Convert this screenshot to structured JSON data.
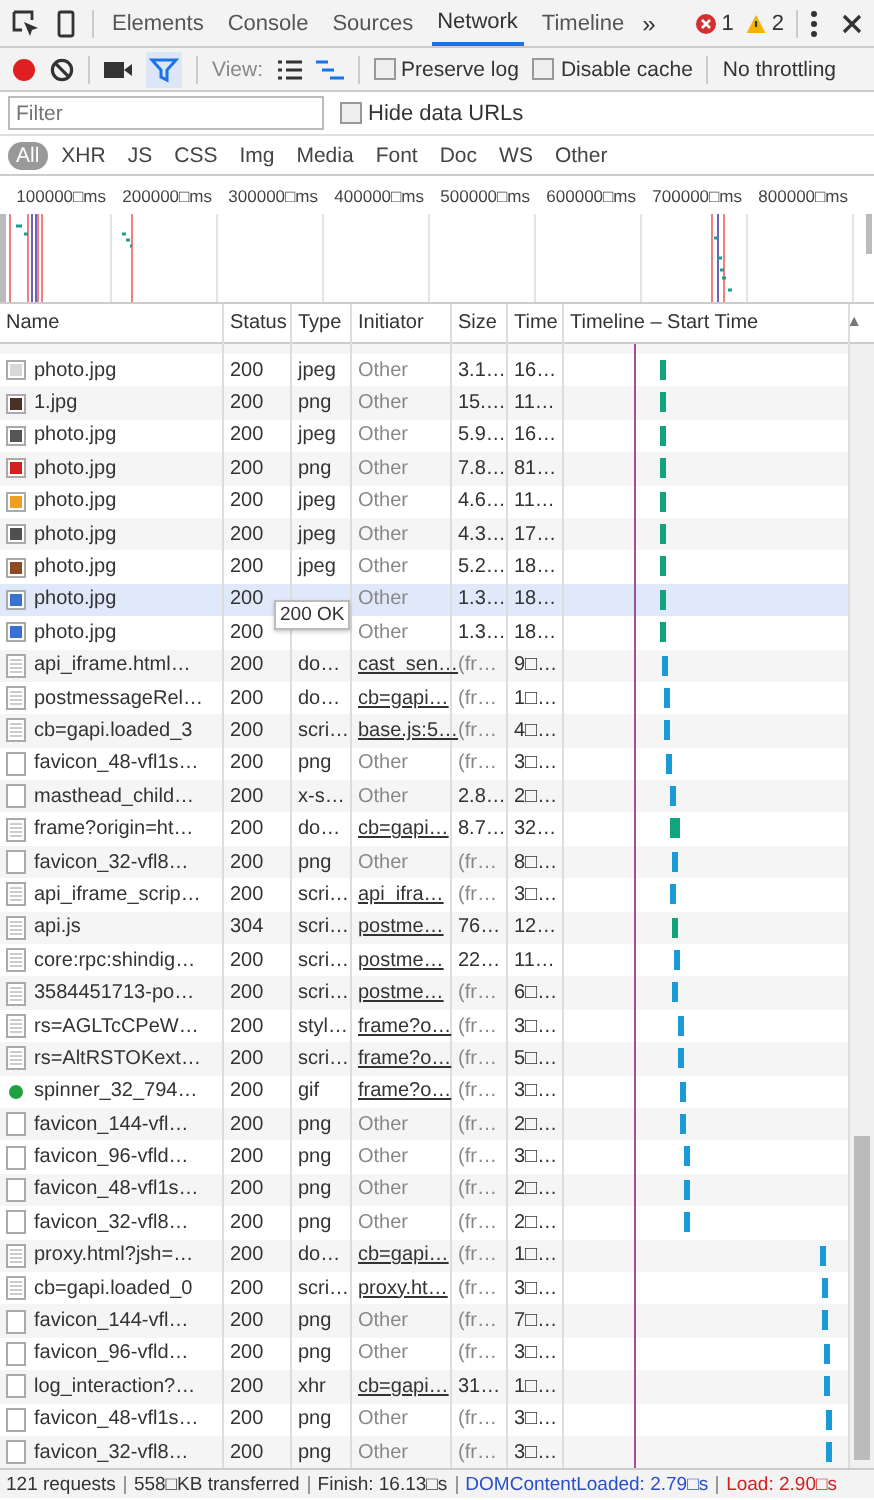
{
  "toolbar": {
    "tabs": [
      {
        "label": "Elements",
        "selected": false
      },
      {
        "label": "Console",
        "selected": false
      },
      {
        "label": "Sources",
        "selected": false
      },
      {
        "label": "Network",
        "selected": true
      },
      {
        "label": "Timeline",
        "selected": false
      }
    ],
    "more": "»",
    "errors": "1",
    "warnings": "2"
  },
  "controls": {
    "recording": true,
    "filter_on": true,
    "view_label": "View:",
    "preserve_log": {
      "label": "Preserve log",
      "checked": false
    },
    "disable_cache": {
      "label": "Disable cache",
      "checked": false
    },
    "throttling": "No throttling"
  },
  "filter": {
    "placeholder": "Filter",
    "hide_data_urls": {
      "label": "Hide data URLs",
      "checked": false
    }
  },
  "types": [
    {
      "label": "All",
      "selected": true
    },
    {
      "label": "XHR",
      "selected": false
    },
    {
      "label": "JS",
      "selected": false
    },
    {
      "label": "CSS",
      "selected": false
    },
    {
      "label": "Img",
      "selected": false
    },
    {
      "label": "Media",
      "selected": false
    },
    {
      "label": "Font",
      "selected": false
    },
    {
      "label": "Doc",
      "selected": false
    },
    {
      "label": "WS",
      "selected": false
    },
    {
      "label": "Other",
      "selected": false
    }
  ],
  "overview": {
    "ticks": [
      "100000□ms",
      "200000□ms",
      "300000□ms",
      "400000□ms",
      "500000□ms",
      "600000□ms",
      "700000□ms",
      "800000□ms"
    ]
  },
  "table": {
    "columns": [
      "Name",
      "Status",
      "Type",
      "Initiator",
      "Size",
      "Time",
      "Timeline – Start Time"
    ],
    "sort_indicator": "▲",
    "rows": [
      {
        "name": "photo.jpg",
        "status": "200",
        "type": "jpeg",
        "initiator": "Other",
        "link": false,
        "size": "3.1…",
        "time": "16…",
        "kind": "thumb",
        "color": "#d8d8d8",
        "highlighted": false
      },
      {
        "name": "1.jpg",
        "status": "200",
        "type": "png",
        "initiator": "Other",
        "link": false,
        "size": "15.…",
        "time": "11…",
        "kind": "thumb",
        "color": "#4a3028",
        "highlighted": false
      },
      {
        "name": "photo.jpg",
        "status": "200",
        "type": "jpeg",
        "initiator": "Other",
        "link": false,
        "size": "5.9…",
        "time": "16…",
        "kind": "thumb",
        "color": "#555555",
        "highlighted": false
      },
      {
        "name": "photo.jpg",
        "status": "200",
        "type": "png",
        "initiator": "Other",
        "link": false,
        "size": "7.8…",
        "time": "81…",
        "kind": "thumb",
        "color": "#d42020",
        "highlighted": false
      },
      {
        "name": "photo.jpg",
        "status": "200",
        "type": "jpeg",
        "initiator": "Other",
        "link": false,
        "size": "4.6…",
        "time": "11…",
        "kind": "thumb",
        "color": "#f0a020",
        "highlighted": false
      },
      {
        "name": "photo.jpg",
        "status": "200",
        "type": "jpeg",
        "initiator": "Other",
        "link": false,
        "size": "4.3…",
        "time": "17…",
        "kind": "thumb",
        "color": "#505050",
        "highlighted": false
      },
      {
        "name": "photo.jpg",
        "status": "200",
        "type": "jpeg",
        "initiator": "Other",
        "link": false,
        "size": "5.2…",
        "time": "18…",
        "kind": "thumb",
        "color": "#8a4a28",
        "highlighted": false
      },
      {
        "name": "photo.jpg",
        "status": "200",
        "initiator": "Other",
        "link": false,
        "size": "1.3…",
        "time": "18…",
        "kind": "thumb",
        "color": "#3a70d0",
        "highlighted": true
      },
      {
        "name": "photo.jpg",
        "status": "200",
        "initiator": "Other",
        "link": false,
        "size": "1.3…",
        "time": "18…",
        "kind": "thumb",
        "color": "#3a70d0",
        "highlighted": false
      },
      {
        "name": "api_iframe.html…",
        "status": "200",
        "type": "do…",
        "initiator": "cast_sen…",
        "link": true,
        "size": "(fr…",
        "time": "9□…",
        "kind": "doc",
        "highlighted": false
      },
      {
        "name": "postmessageRel…",
        "status": "200",
        "type": "do…",
        "initiator": "cb=gapi…",
        "link": true,
        "size": "(fr…",
        "time": "1□…",
        "kind": "doc",
        "highlighted": false
      },
      {
        "name": "cb=gapi.loaded_3",
        "status": "200",
        "type": "scri…",
        "initiator": "base.js:5…",
        "link": true,
        "size": "(fr…",
        "time": "4□…",
        "kind": "doc",
        "highlighted": false
      },
      {
        "name": "favicon_48-vfl1s…",
        "status": "200",
        "type": "png",
        "initiator": "Other",
        "link": false,
        "size": "(fr…",
        "time": "3□…",
        "kind": "blank",
        "highlighted": false
      },
      {
        "name": "masthead_child…",
        "status": "200",
        "type": "x-s…",
        "initiator": "Other",
        "link": false,
        "size": "2.8…",
        "time": "2□…",
        "kind": "blank",
        "highlighted": false
      },
      {
        "name": "frame?origin=ht…",
        "status": "200",
        "type": "do…",
        "initiator": "cb=gapi…",
        "link": true,
        "size": "8.7…",
        "time": "32…",
        "kind": "doc",
        "highlighted": false
      },
      {
        "name": "favicon_32-vfl8…",
        "status": "200",
        "type": "png",
        "initiator": "Other",
        "link": false,
        "size": "(fr…",
        "time": "8□…",
        "kind": "blank",
        "highlighted": false
      },
      {
        "name": "api_iframe_scrip…",
        "status": "200",
        "type": "scri…",
        "initiator": "api_ifra…",
        "link": true,
        "size": "(fr…",
        "time": "3□…",
        "kind": "doc",
        "highlighted": false
      },
      {
        "name": "api.js",
        "status": "304",
        "type": "scri…",
        "initiator": "postme…",
        "link": true,
        "size": "76…",
        "time": "12…",
        "kind": "doc",
        "highlighted": false
      },
      {
        "name": "core:rpc:shindig…",
        "status": "200",
        "type": "scri…",
        "initiator": "postme…",
        "link": true,
        "size": "22…",
        "time": "11…",
        "kind": "doc",
        "highlighted": false
      },
      {
        "name": "3584451713-po…",
        "status": "200",
        "type": "scri…",
        "initiator": "postme…",
        "link": true,
        "size": "(fr…",
        "time": "6□…",
        "kind": "doc",
        "highlighted": false
      },
      {
        "name": "rs=AGLTcCPeW…",
        "status": "200",
        "type": "styl…",
        "initiator": "frame?o…",
        "link": true,
        "size": "(fr…",
        "time": "3□…",
        "kind": "doc",
        "highlighted": false
      },
      {
        "name": "rs=AltRSTOKext…",
        "status": "200",
        "type": "scri…",
        "initiator": "frame?o…",
        "link": true,
        "size": "(fr…",
        "time": "5□…",
        "kind": "doc",
        "highlighted": false
      },
      {
        "name": "spinner_32_794…",
        "status": "200",
        "type": "gif",
        "initiator": "frame?o…",
        "link": true,
        "size": "(fr…",
        "time": "3□…",
        "kind": "dot",
        "color": "#20a040",
        "highlighted": false
      },
      {
        "name": "favicon_144-vfl…",
        "status": "200",
        "type": "png",
        "initiator": "Other",
        "link": false,
        "size": "(fr…",
        "time": "2□…",
        "kind": "blank",
        "highlighted": false
      },
      {
        "name": "favicon_96-vfld…",
        "status": "200",
        "type": "png",
        "initiator": "Other",
        "link": false,
        "size": "(fr…",
        "time": "3□…",
        "kind": "blank",
        "highlighted": false
      },
      {
        "name": "favicon_48-vfl1s…",
        "status": "200",
        "type": "png",
        "initiator": "Other",
        "link": false,
        "size": "(fr…",
        "time": "2□…",
        "kind": "blank",
        "highlighted": false
      },
      {
        "name": "favicon_32-vfl8…",
        "status": "200",
        "type": "png",
        "initiator": "Other",
        "link": false,
        "size": "(fr…",
        "time": "2□…",
        "kind": "blank",
        "highlighted": false
      },
      {
        "name": "proxy.html?jsh=…",
        "status": "200",
        "type": "do…",
        "initiator": "cb=gapi…",
        "link": true,
        "size": "(fr…",
        "time": "1□…",
        "kind": "doc",
        "highlighted": false
      },
      {
        "name": "cb=gapi.loaded_0",
        "status": "200",
        "type": "scri…",
        "initiator": "proxy.ht…",
        "link": true,
        "size": "(fr…",
        "time": "3□…",
        "kind": "doc",
        "highlighted": false
      },
      {
        "name": "favicon_144-vfl…",
        "status": "200",
        "type": "png",
        "initiator": "Other",
        "link": false,
        "size": "(fr…",
        "time": "7□…",
        "kind": "blank",
        "highlighted": false
      },
      {
        "name": "favicon_96-vfld…",
        "status": "200",
        "type": "png",
        "initiator": "Other",
        "link": false,
        "size": "(fr…",
        "time": "3□…",
        "kind": "blank",
        "highlighted": false
      },
      {
        "name": "log_interaction?…",
        "status": "200",
        "type": "xhr",
        "initiator": "cb=gapi…",
        "link": true,
        "size": "31…",
        "time": "1□…",
        "kind": "blank",
        "highlighted": false
      },
      {
        "name": "favicon_48-vfl1s…",
        "status": "200",
        "type": "png",
        "initiator": "Other",
        "link": false,
        "size": "(fr…",
        "time": "3□…",
        "kind": "blank",
        "highlighted": false
      },
      {
        "name": "favicon_32-vfl8…",
        "status": "200",
        "type": "png",
        "initiator": "Other",
        "link": false,
        "size": "(fr…",
        "time": "3□…",
        "kind": "blank",
        "highlighted": false
      }
    ]
  },
  "tooltip": "200 OK",
  "status_bar": {
    "requests": "121 requests",
    "transferred": "558□KB transferred",
    "finish": "Finish: 16.13□s",
    "dom_content_loaded": "DOMContentLoaded: 2.79□s",
    "load": "Load: 2.90□s"
  }
}
